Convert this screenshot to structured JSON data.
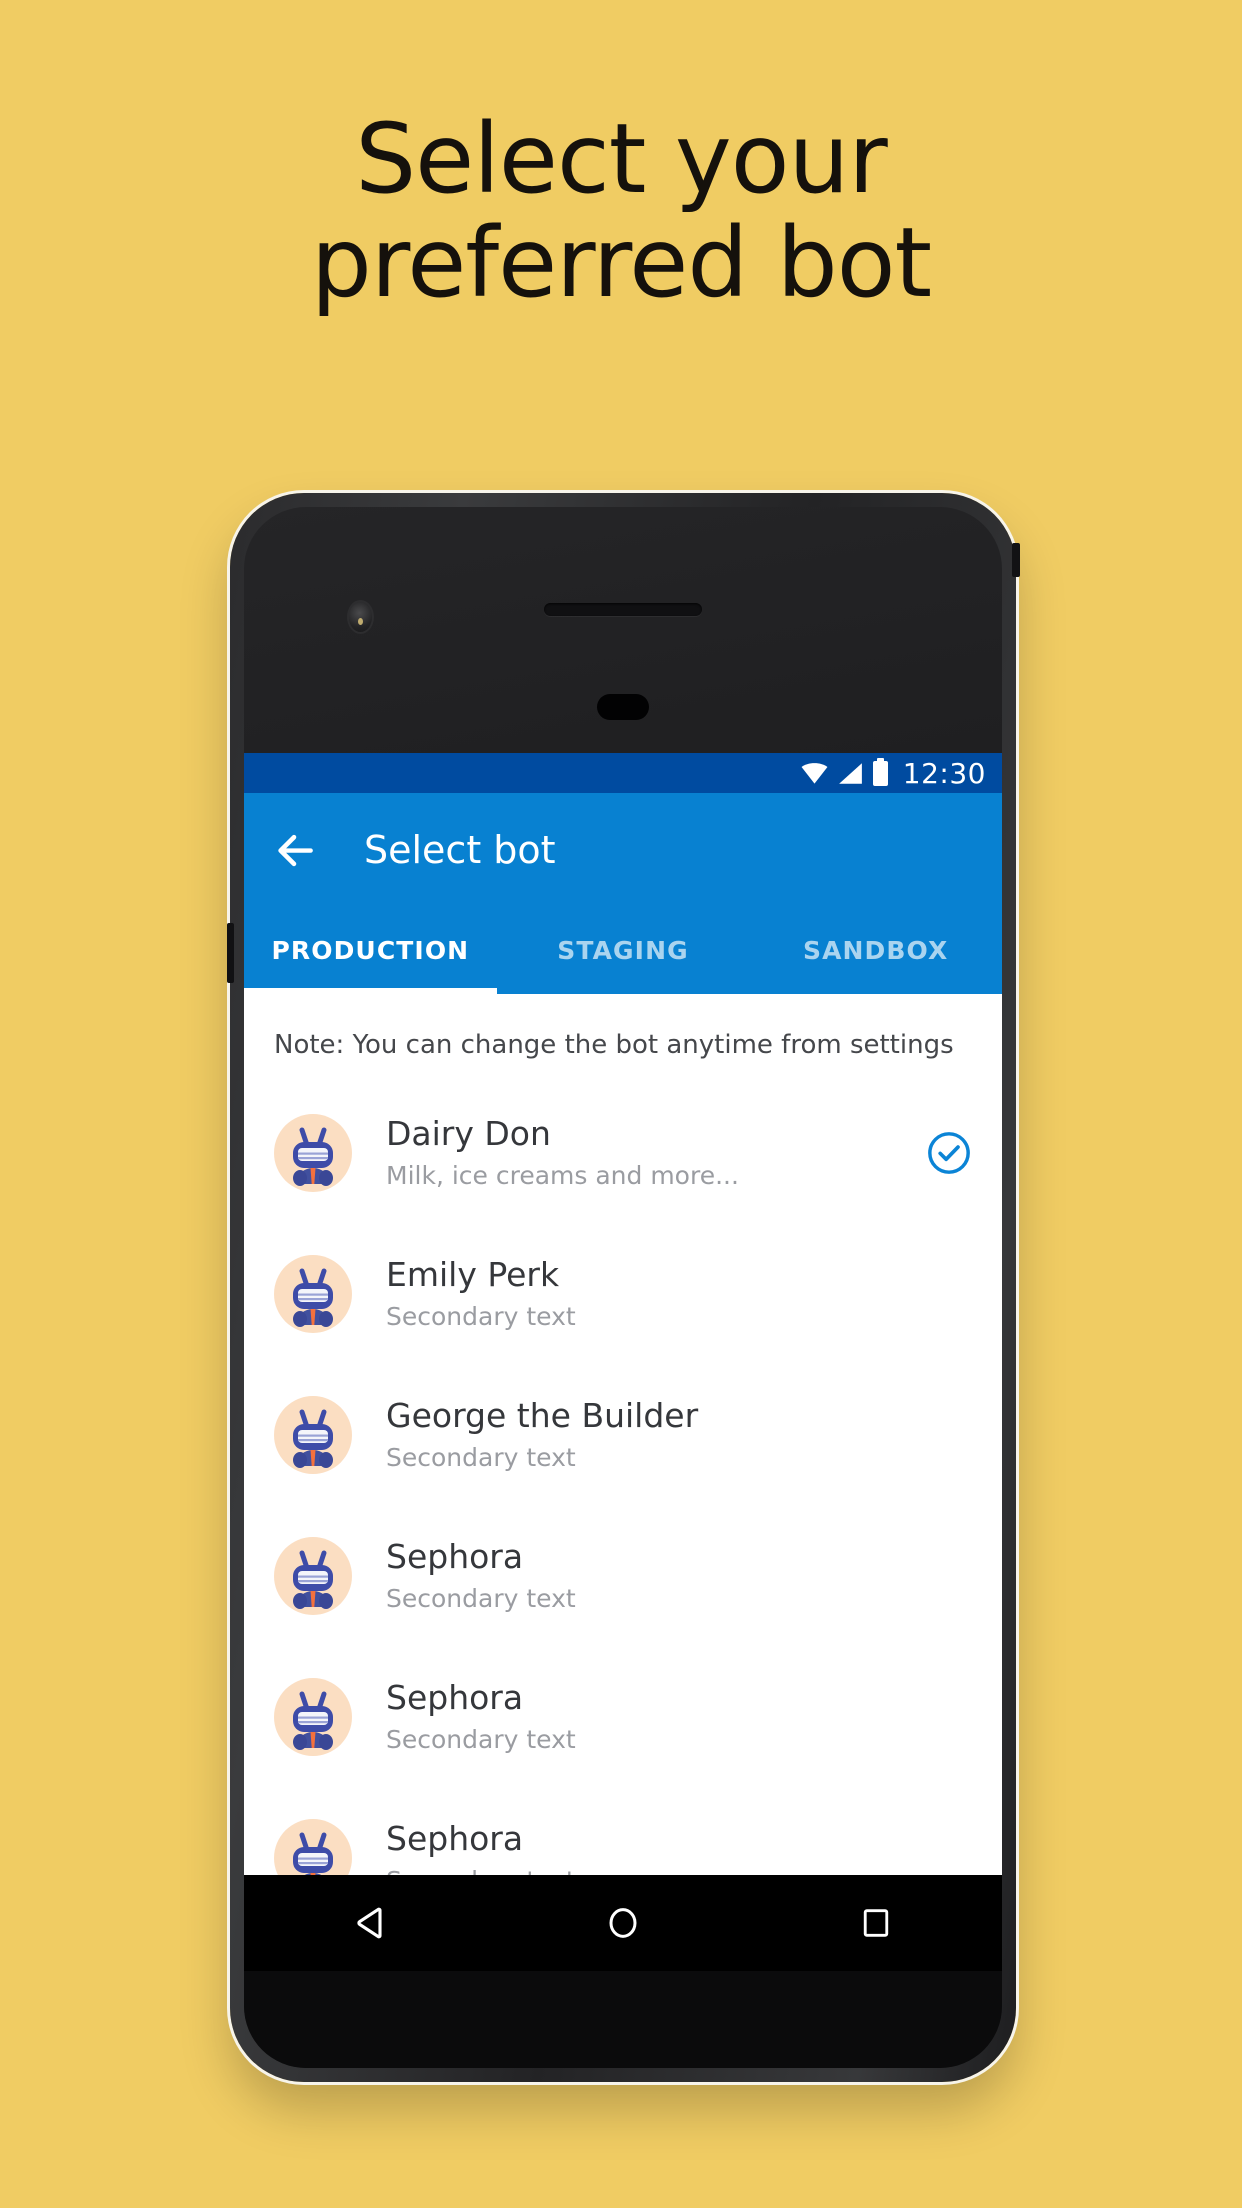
{
  "background_color": "#F0CC63",
  "headline": {
    "line1": "Select your",
    "line2": "preferred bot"
  },
  "phone": {
    "camera_icon": "front-camera",
    "speaker_icon": "earpiece-speaker",
    "sensor_icon": "proximity-sensor"
  },
  "status_bar": {
    "background": "#004BA0",
    "time": "12:30",
    "icons": [
      "wifi-icon",
      "signal-icon",
      "battery-icon"
    ]
  },
  "app_bar": {
    "background": "#0881D1",
    "back_icon": "back-arrow-icon",
    "title": "Select bot"
  },
  "tabs": {
    "active_index": 0,
    "indicator_color": "#FFFFFF",
    "items": [
      {
        "label": "PRODUCTION"
      },
      {
        "label": "STAGING"
      },
      {
        "label": "SANDBOX"
      }
    ]
  },
  "content": {
    "note": "Note: You can change the bot anytime from settings",
    "selected_color": "#0B84D6",
    "rows": [
      {
        "title": "Dairy Don",
        "subtitle": "Milk, ice creams and more...",
        "selected": true,
        "avatar_icon": "bot-avatar"
      },
      {
        "title": "Emily Perk",
        "subtitle": "Secondary text",
        "selected": false,
        "avatar_icon": "bot-avatar"
      },
      {
        "title": "George the Builder",
        "subtitle": "Secondary text",
        "selected": false,
        "avatar_icon": "bot-avatar"
      },
      {
        "title": "Sephora",
        "subtitle": "Secondary text",
        "selected": false,
        "avatar_icon": "bot-avatar"
      },
      {
        "title": "Sephora",
        "subtitle": "Secondary text",
        "selected": false,
        "avatar_icon": "bot-avatar"
      },
      {
        "title": "Sephora",
        "subtitle": "Secondary text",
        "selected": false,
        "avatar_icon": "bot-avatar"
      }
    ]
  },
  "nav_bar": {
    "background": "#000000",
    "buttons": [
      {
        "icon": "android-back-icon"
      },
      {
        "icon": "android-home-icon"
      },
      {
        "icon": "android-recents-icon"
      }
    ]
  }
}
